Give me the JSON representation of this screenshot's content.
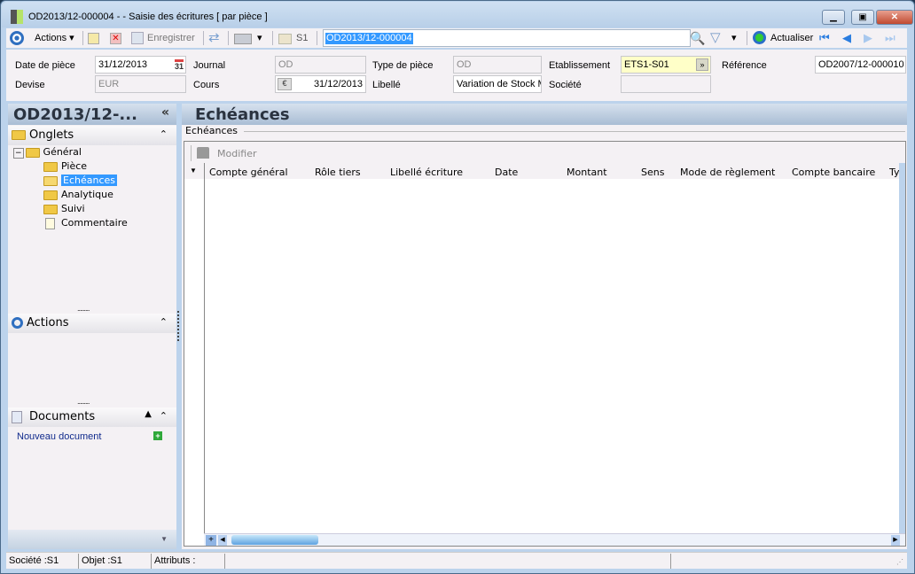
{
  "window": {
    "title": "OD2013/12-000004 -  -  Saisie des écritures [ par pièce ]",
    "minimize": "▁",
    "maximize": "▣",
    "close": "✕"
  },
  "toolbar": {
    "actions": "Actions",
    "save": "Enregistrer",
    "company": "S1",
    "search_value": "OD2013/12-000004",
    "refresh": "Actualiser"
  },
  "form": {
    "date_label": "Date de pièce",
    "date_value": "31/12/2013",
    "calendar": "31",
    "devise_label": "Devise",
    "devise_value": "EUR",
    "journal_label": "Journal",
    "journal_value": "OD",
    "cours_label": "Cours",
    "cours_value": "31/12/2013",
    "currency_symbol": "€",
    "type_label": "Type de pièce",
    "type_value": "OD",
    "libelle_label": "Libellé",
    "libelle_value": "Variation de Stock M",
    "etab_label": "Etablissement",
    "etab_value": "ETS1-S01",
    "societe_label": "Société",
    "societe_value": "",
    "ref_label": "Référence",
    "ref_value": "OD2007/12-000010"
  },
  "left": {
    "title": "OD2013/12-...",
    "collapse": "«",
    "onglets": "Onglets",
    "tree_root": "Général",
    "tree_items": [
      "Pièce",
      "Echéances",
      "Analytique",
      "Suivi",
      "Commentaire"
    ],
    "actions": "Actions",
    "documents": "Documents",
    "new_doc": "Nouveau document"
  },
  "main": {
    "title": "Echéances",
    "group": "Echéances",
    "modify": "Modifier",
    "columns": [
      "Compte général",
      "Rôle tiers",
      "Libellé écriture",
      "Date",
      "Montant",
      "Sens",
      "Mode de règlement",
      "Compte bancaire",
      "Typ"
    ]
  },
  "status": {
    "societe": "Société :S1",
    "objet": "Objet :S1",
    "attributs": "Attributs :"
  }
}
